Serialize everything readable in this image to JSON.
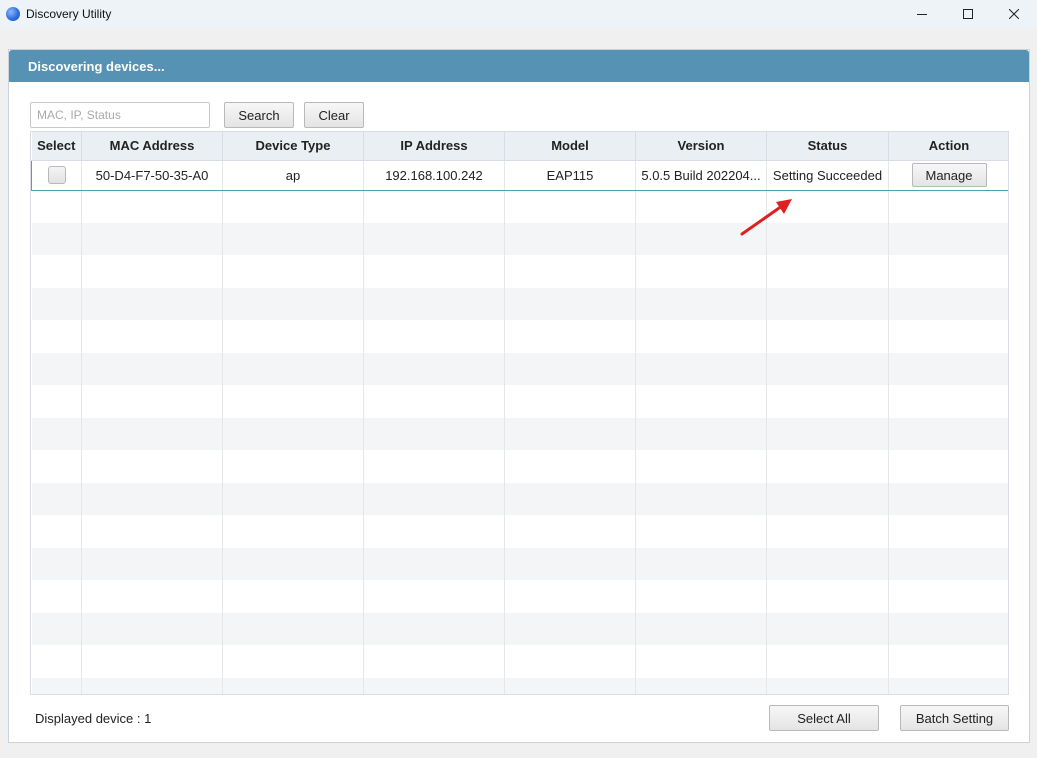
{
  "window": {
    "title": "Discovery Utility",
    "app_icon": "globe-icon"
  },
  "panel": {
    "header": "Discovering devices..."
  },
  "search": {
    "placeholder": "MAC, IP, Status",
    "value": "",
    "search_label": "Search",
    "clear_label": "Clear"
  },
  "table": {
    "columns": [
      "Select",
      "MAC Address",
      "Device Type",
      "IP Address",
      "Model",
      "Version",
      "Status",
      "Action"
    ],
    "rows": [
      {
        "selected": false,
        "mac": "50-D4-F7-50-35-A0",
        "device_type": "ap",
        "ip": "192.168.100.242",
        "model": "EAP115",
        "version": "5.0.5 Build 202204...",
        "status": "Setting Succeeded",
        "action_label": "Manage"
      }
    ]
  },
  "footer": {
    "displayed": "Displayed device : 1",
    "select_all_label": "Select All",
    "batch_setting_label": "Batch Setting"
  },
  "colors": {
    "header_bar": "#5592b3",
    "row_highlight_border": "#4aa6a8",
    "annotation_arrow": "#e02020"
  }
}
